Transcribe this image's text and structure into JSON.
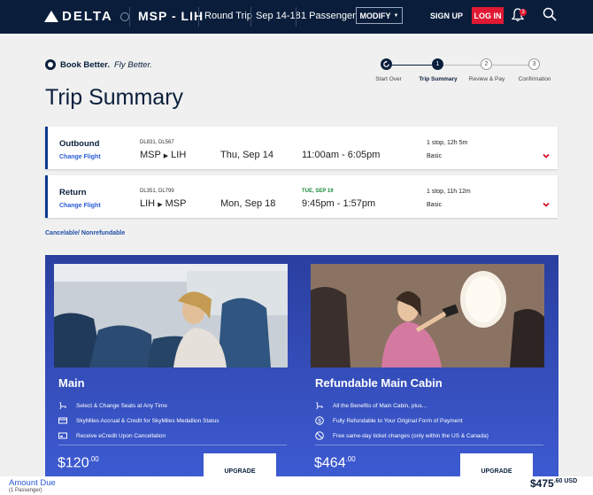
{
  "header": {
    "brand": "DELTA",
    "route": "MSP - LIH",
    "trip_type": "Round Trip",
    "dates": "Sep 14-18",
    "passengers": "1 Passenger",
    "modify_label": "MODIFY",
    "signup_label": "SIGN UP",
    "login_label": "LOG IN",
    "notification_count": "3"
  },
  "page": {
    "tagline_bold": "Book Better.",
    "tagline_italic": "Fly Better.",
    "title": "Trip Summary"
  },
  "steps": [
    {
      "label": "Start Over",
      "number": "",
      "state": "icon"
    },
    {
      "label": "Trip Summary",
      "number": "1",
      "state": "active"
    },
    {
      "label": "Review & Pay",
      "number": "2",
      "state": "pending"
    },
    {
      "label": "Confirmation",
      "number": "3",
      "state": "pending"
    }
  ],
  "flights": [
    {
      "type": "Outbound",
      "change_label": "Change Flight",
      "flight_numbers": "DL831, DL567",
      "from": "MSP",
      "to": "LIH",
      "date": "Thu, Sep 14",
      "next_day": "",
      "time": "11:00am - 6:05pm",
      "stops": "1 stop, 12h 5m",
      "fare": "Basic"
    },
    {
      "type": "Return",
      "change_label": "Change Flight",
      "flight_numbers": "DL351, DL799",
      "from": "LIH",
      "to": "MSP",
      "date": "Mon, Sep 18",
      "next_day": "TUE, SEP 19",
      "time": "9:45pm - 1:57pm",
      "stops": "1 stop, 11h 12m",
      "fare": "Basic"
    }
  ],
  "cancel_note": "Cancelable/ Nonrefundable",
  "fares": [
    {
      "name": "Main",
      "features": [
        {
          "icon": "seat-icon",
          "text": "Select & Change Seats at Any Time"
        },
        {
          "icon": "skymiles-card-icon",
          "text": "SkyMiles Accrual & Credit for SkyMiles Medallion Status"
        },
        {
          "icon": "ecredit-card-icon",
          "text": "Receive eCredit Upon Cancellation"
        }
      ],
      "price_dollars": "$120",
      "price_cents": ".00",
      "button_label": "UPGRADE"
    },
    {
      "name": "Refundable Main Cabin",
      "features": [
        {
          "icon": "seat-icon",
          "text": "All the Benefits of Main Cabin, plus..."
        },
        {
          "icon": "dollar-icon",
          "text": "Fully Refundable to Your Original Form of Payment"
        },
        {
          "icon": "no-change-fee-icon",
          "text": "Free same-day ticket changes (only within the US & Canada)"
        }
      ],
      "price_dollars": "$464",
      "price_cents": ".00",
      "button_label": "UPGRADE"
    }
  ],
  "footer": {
    "amount_label": "Amount Due",
    "amount_sub": "(1 Passenger)",
    "total_dollars": "$475",
    "total_cents": ".60 USD"
  },
  "colors": {
    "header_bg": "#0a1e3c",
    "login_red": "#e01933",
    "link_blue": "#2a5bd7",
    "fare_card": "#3348b5"
  }
}
